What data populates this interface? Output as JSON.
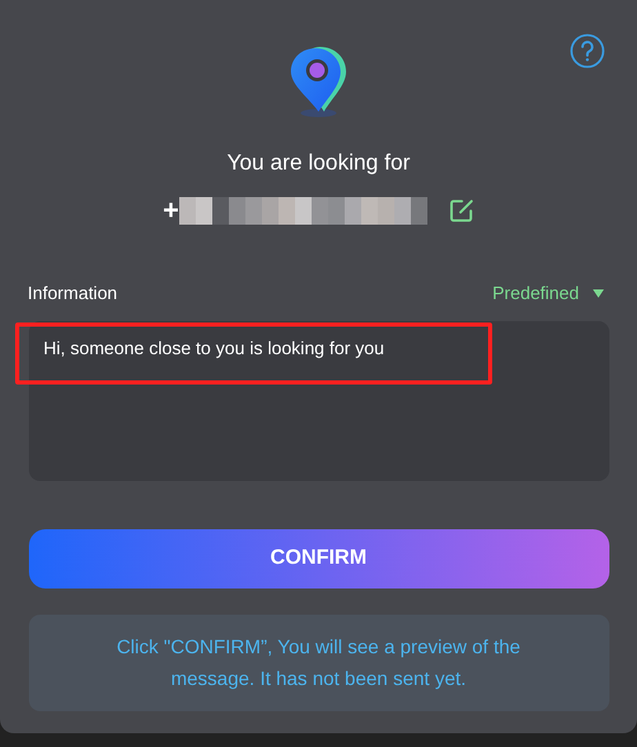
{
  "header": {
    "title": "You are looking for",
    "phone_prefix": "+"
  },
  "information": {
    "label": "Information",
    "mode": "Predefined",
    "message": "Hi, someone close to you is looking for you",
    "highlighted": true
  },
  "confirm_button": "CONFIRM",
  "notice": "Click \"CONFIRM”, You will see a preview of the message. It has not been sent yet."
}
